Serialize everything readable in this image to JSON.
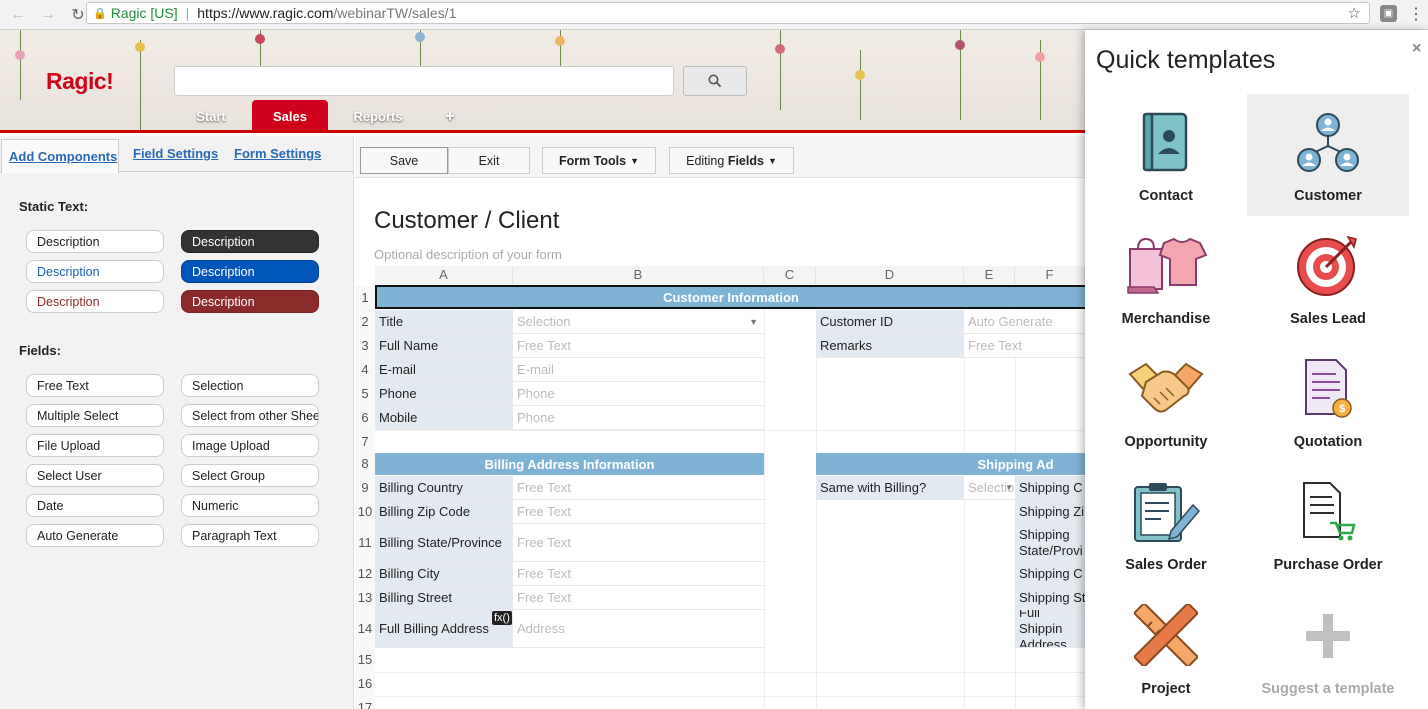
{
  "browser": {
    "site_name": "Ragic [US]",
    "url_host": "https://www.ragic.com",
    "url_path": "/webinarTW/sales/1"
  },
  "header": {
    "logo": "Ragic!",
    "tabs": [
      {
        "label": "Start"
      },
      {
        "label": "Sales"
      },
      {
        "label": "Reports"
      },
      {
        "label": "+"
      }
    ]
  },
  "left_panel": {
    "tabs": [
      "Add Components",
      "Field Settings",
      "Form Settings"
    ],
    "static_text_label": "Static Text:",
    "static_text": [
      "Description",
      "Description",
      "Description",
      "Description",
      "Description",
      "Description"
    ],
    "fields_label": "Fields:",
    "fields": [
      "Free Text",
      "Selection",
      "Multiple Select",
      "Select from other Sheet",
      "File Upload",
      "Image Upload",
      "Select User",
      "Select Group",
      "Date",
      "Numeric",
      "Auto Generate",
      "Paragraph Text"
    ]
  },
  "toolbar": {
    "save": "Save",
    "exit": "Exit",
    "form_tools": "Form Tools",
    "editing_prefix": "Editing",
    "editing_bold": "Fields"
  },
  "sheet": {
    "title": "Customer / Client",
    "description": "Optional description of your form",
    "columns": [
      "A",
      "B",
      "C",
      "D",
      "E",
      "F"
    ],
    "rows": [
      "1",
      "2",
      "3",
      "4",
      "5",
      "6",
      "7",
      "8",
      "9",
      "10",
      "11",
      "12",
      "13",
      "14",
      "15",
      "16",
      "17"
    ],
    "customer_info": "Customer Information",
    "billing_info": "Billing Address Information",
    "shipping_info": "Shipping Ad",
    "fx": "fx()",
    "left_fields": [
      {
        "label": "Title",
        "value": "Selection"
      },
      {
        "label": "Full Name",
        "value": "Free Text"
      },
      {
        "label": "E-mail",
        "value": "E-mail"
      },
      {
        "label": "Phone",
        "value": "Phone"
      },
      {
        "label": "Mobile",
        "value": "Phone"
      }
    ],
    "right_fields": [
      {
        "label": "Customer ID",
        "value": "Auto Generate"
      },
      {
        "label": "Remarks",
        "value": "Free Text"
      }
    ],
    "billing_fields": [
      {
        "label": "Billing Country",
        "value": "Free Text"
      },
      {
        "label": "Billing Zip Code",
        "value": "Free Text"
      },
      {
        "label": "Billing State/Province",
        "value": "Free Text"
      },
      {
        "label": "Billing City",
        "value": "Free Text"
      },
      {
        "label": "Billing Street",
        "value": "Free Text"
      },
      {
        "label": "Full Billing Address",
        "value": "Address"
      }
    ],
    "same_with_billing": {
      "label": "Same with Billing?",
      "value": "Selectio"
    },
    "shipping_fields": [
      "Shipping C",
      "Shipping Zi",
      "Shipping State/Provi",
      "Shipping C",
      "Shipping St",
      "Full Shippin Address"
    ]
  },
  "quick_templates": {
    "title": "Quick templates",
    "close": "×",
    "items": [
      {
        "label": "Contact",
        "icon": "contact-book-icon"
      },
      {
        "label": "Customer",
        "icon": "customer-network-icon"
      },
      {
        "label": "Merchandise",
        "icon": "shopping-bag-icon"
      },
      {
        "label": "Sales Lead",
        "icon": "target-icon"
      },
      {
        "label": "Opportunity",
        "icon": "handshake-icon"
      },
      {
        "label": "Quotation",
        "icon": "quotation-icon"
      },
      {
        "label": "Sales Order",
        "icon": "clipboard-icon"
      },
      {
        "label": "Purchase Order",
        "icon": "purchase-order-icon"
      },
      {
        "label": "Project",
        "icon": "ruler-pencil-icon"
      },
      {
        "label": "Suggest a template",
        "icon": "plus-icon"
      }
    ]
  }
}
